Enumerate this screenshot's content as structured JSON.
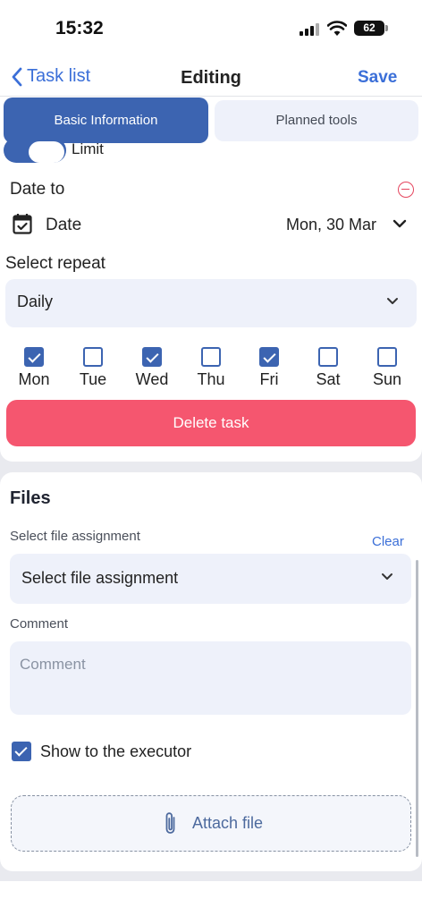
{
  "status_bar": {
    "time": "15:32",
    "battery": "62"
  },
  "nav": {
    "back_label": "Task list",
    "title": "Editing",
    "save_label": "Save"
  },
  "tabs": [
    {
      "label": "Basic Information",
      "active": true
    },
    {
      "label": "Planned tools",
      "active": false
    }
  ],
  "limit": {
    "label": "Limit",
    "on": true
  },
  "date_to": {
    "label": "Date to",
    "date_label": "Date",
    "date_value": "Mon, 30 Mar"
  },
  "repeat": {
    "label": "Select repeat",
    "value": "Daily",
    "days": [
      {
        "label": "Mon",
        "checked": true
      },
      {
        "label": "Tue",
        "checked": false
      },
      {
        "label": "Wed",
        "checked": true
      },
      {
        "label": "Thu",
        "checked": false
      },
      {
        "label": "Fri",
        "checked": true
      },
      {
        "label": "Sat",
        "checked": false
      },
      {
        "label": "Sun",
        "checked": false
      }
    ]
  },
  "delete_label": "Delete task",
  "files": {
    "title": "Files",
    "assignment_label": "Select file assignment",
    "clear_label": "Clear",
    "assignment_value": "Select file assignment",
    "comment_label": "Comment",
    "comment_placeholder": "Comment",
    "show_executor_label": "Show to the executor",
    "show_executor_checked": true,
    "attach_label": "Attach file"
  },
  "colors": {
    "accent": "#3c64b1",
    "link": "#3b6fd8",
    "danger": "#f5566f",
    "field_bg": "#eef1fa"
  }
}
